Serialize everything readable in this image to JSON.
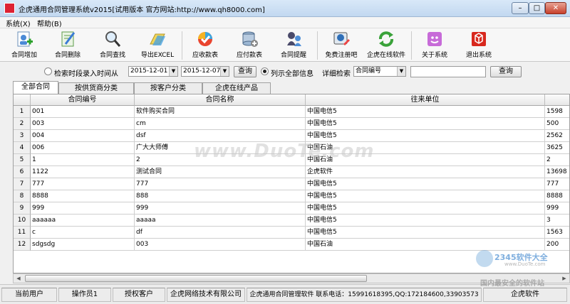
{
  "window": {
    "title": "企虎通用合同管理系统v2015[试用版本 官方网站:http://www.qh8000.com]",
    "min_glyph": "–",
    "max_glyph": "□",
    "close_glyph": "✕"
  },
  "menubar": {
    "items": [
      {
        "label": "系统(X)"
      },
      {
        "label": "帮助(B)"
      }
    ]
  },
  "toolbar": {
    "items": [
      {
        "label": "合同增加",
        "icon": "contract-add-icon"
      },
      {
        "label": "合同删除",
        "icon": "contract-delete-icon"
      },
      {
        "label": "合同查找",
        "icon": "magnifier-icon"
      },
      {
        "label": "导出EXCEL",
        "icon": "excel-export-icon"
      },
      {
        "label": "应收款表",
        "icon": "receivable-icon"
      },
      {
        "label": "应付款表",
        "icon": "database-icon"
      },
      {
        "label": "合同提醒",
        "icon": "reminder-icon"
      },
      {
        "label": "免费注册吧",
        "icon": "register-icon"
      },
      {
        "label": "企虎在线软件",
        "icon": "refresh-online-icon"
      },
      {
        "label": "关于系统",
        "icon": "about-icon"
      },
      {
        "label": "退出系统",
        "icon": "exit-icon"
      }
    ]
  },
  "filter": {
    "by_time_label": "检索时段录入时间从",
    "date_from": "2015-12-01",
    "date_to": "2015-12-07",
    "query_label": "查询",
    "show_all_label": "列示全部信息",
    "detail_label": "详细检索",
    "field_select": "合同编号",
    "keyword": "",
    "query2_label": "查询"
  },
  "tabs": [
    {
      "label": "全部合同"
    },
    {
      "label": "按供货商分类"
    },
    {
      "label": "按客户分类"
    },
    {
      "label": "企虎在线产品"
    }
  ],
  "table": {
    "columns": [
      "合同编号",
      "合同名称",
      "往来单位"
    ],
    "rows": [
      {
        "num": "1",
        "code": "001",
        "name": "软件购买合同",
        "unit": "中国电信5",
        "amount": "1598"
      },
      {
        "num": "2",
        "code": "003",
        "name": "cm",
        "unit": "中国电信5",
        "amount": "500"
      },
      {
        "num": "3",
        "code": "004",
        "name": "dsf",
        "unit": "中国电信5",
        "amount": "2562"
      },
      {
        "num": "4",
        "code": "006",
        "name": "广大大师傅",
        "unit": "中国石油",
        "amount": "3625"
      },
      {
        "num": "5",
        "code": "1",
        "name": "2",
        "unit": "中国石油",
        "amount": "2"
      },
      {
        "num": "6",
        "code": "1122",
        "name": "测试合同",
        "unit": "企虎软件",
        "amount": "13698"
      },
      {
        "num": "7",
        "code": "777",
        "name": "777",
        "unit": "中国电信5",
        "amount": "777"
      },
      {
        "num": "8",
        "code": "8888",
        "name": "888",
        "unit": "中国电信5",
        "amount": "8888"
      },
      {
        "num": "9",
        "code": "999",
        "name": "999",
        "unit": "中国电信5",
        "amount": "999"
      },
      {
        "num": "10",
        "code": "aaaaaa",
        "name": "aaaaa",
        "unit": "中国电信5",
        "amount": "3"
      },
      {
        "num": "11",
        "code": "c",
        "name": "df",
        "unit": "中国电信5",
        "amount": "1563"
      },
      {
        "num": "12",
        "code": "sdgsdg",
        "name": "003",
        "unit": "中国石油",
        "amount": "200"
      }
    ]
  },
  "statusbar": {
    "current_user_label": "当前用户",
    "operator": "操作员1",
    "licensed_label": "授权客户",
    "company": "企虎网络技术有限公司",
    "contact": "企虎通用合同管理软件  联系电话：15991618395,QQ:172184600,33903573",
    "brand": "企虎软件"
  },
  "watermarks": {
    "duote": "www.DuoTe.com",
    "site2345": "2345软件大全",
    "site2345_url": "www.DuoTe.com",
    "slogan": "国内最安全的软件站"
  }
}
